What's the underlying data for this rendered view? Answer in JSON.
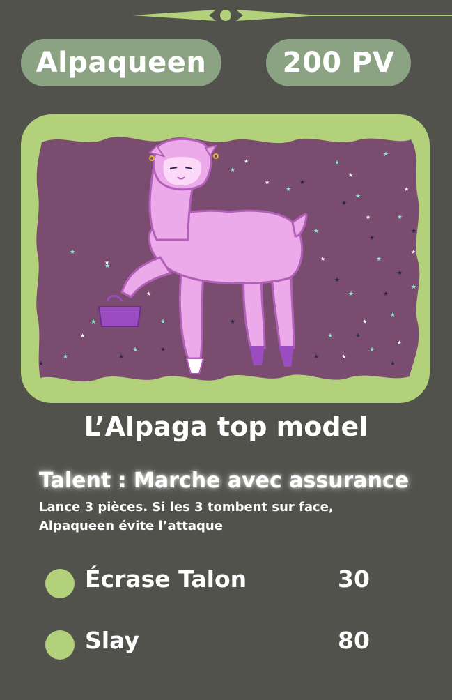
{
  "card": {
    "name": "Alpaqueen",
    "hp": "200 PV",
    "subtitle": "L’Alpaga top model",
    "talent": {
      "title": "Talent : Marche avec assurance",
      "description_line1": "Lance 3 pièces. Si les 3 tombent sur face,",
      "description_line2": "Alpaqueen évite l’attaque"
    },
    "attacks": [
      {
        "name": "Écrase Talon",
        "damage": "30"
      },
      {
        "name": "Slay",
        "damage": "80"
      }
    ]
  },
  "colors": {
    "background": "#52524d",
    "pill": "#8ba383",
    "accent_green": "#b3d07a",
    "art_background": "#7a4c6f",
    "alpaca": "#ecaaea",
    "alpaca_outline": "#b25fb7",
    "purple_accessories": "#9a4cc0"
  },
  "icons": [
    "energy-dot-icon",
    "ornament-divider-icon"
  ]
}
